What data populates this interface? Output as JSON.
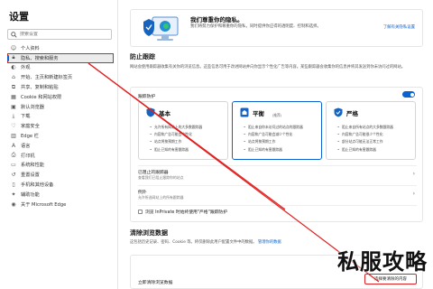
{
  "sidebar": {
    "title": "设置",
    "search_placeholder": "搜索设置",
    "items": [
      {
        "label": "个人资料",
        "icon": "person-icon"
      },
      {
        "label": "隐私、搜索和服务",
        "icon": "lock-icon"
      },
      {
        "label": "外观",
        "icon": "appearance-icon"
      },
      {
        "label": "开始、主页和新建标签页",
        "icon": "home-icon"
      },
      {
        "label": "共享、复制和粘贴",
        "icon": "share-icon"
      },
      {
        "label": "Cookie 和网站权限",
        "icon": "cookie-icon"
      },
      {
        "label": "默认浏览器",
        "icon": "browser-icon"
      },
      {
        "label": "下载",
        "icon": "download-icon"
      },
      {
        "label": "家庭安全",
        "icon": "family-icon"
      },
      {
        "label": "Edge 栏",
        "icon": "edge-bar-icon"
      },
      {
        "label": "语言",
        "icon": "language-icon"
      },
      {
        "label": "打印机",
        "icon": "printer-icon"
      },
      {
        "label": "系统和性能",
        "icon": "system-icon"
      },
      {
        "label": "重置设置",
        "icon": "reset-icon"
      },
      {
        "label": "手机和其他设备",
        "icon": "phone-icon"
      },
      {
        "label": "辅助功能",
        "icon": "accessibility-icon"
      },
      {
        "label": "关于 Microsoft Edge",
        "icon": "edge-logo-icon"
      }
    ]
  },
  "hero": {
    "title": "我们尊重你的隐私。",
    "desc": "我们将努力保护和尊重你的隐私，同时提供你应得的透明度、控制和选择。",
    "link": "了解有关隐私设置"
  },
  "tracking": {
    "title": "防止跟踪",
    "desc": "网站会使用跟踪器收集有关你的浏览信息。这些信息可用于改进网站并向你显示个性化广告等内容。某些跟踪器会收集你的信息并将其发送到你未访问过的网站。",
    "label": "跟踪防护",
    "toggle_on": true,
    "cards": [
      {
        "name": "基本",
        "sub": "",
        "bullets": [
          "允许所有网站上的大多数跟踪器",
          "内容和广告可能会个性化",
          "站点将按预期工作",
          "阻止已知的有害跟踪器"
        ]
      },
      {
        "name": "平衡",
        "sub": "(推荐)",
        "bullets": [
          "阻止来自你未访问过的站点的跟踪器",
          "内容和广告可能会减少个性化",
          "站点将按预期工作",
          "阻止已知的有害跟踪器"
        ]
      },
      {
        "name": "严格",
        "sub": "",
        "bullets": [
          "阻止来自所有站点的大多数跟踪器",
          "内容和广告可能很少个性化",
          "部分站点可能无法正常工作",
          "阻止已知的有害跟踪器"
        ]
      }
    ],
    "rows": [
      {
        "title": "已阻止的跟踪器",
        "desc": "查看我们已阻止跟踪你的站点"
      },
      {
        "title": "例外",
        "desc": "允许所选网站上的所有跟踪器"
      }
    ],
    "inprivate": "浏览 InPrivate 时始终使用\"严格\"跟踪防护"
  },
  "clear": {
    "title": "清除浏览数据",
    "desc": "这包括历史记录、密码、Cookie 等。将仅删除此用户配置文件中的数据。",
    "link": "管理你的数据",
    "row_label": "立即清除浏览数据",
    "button": "选择要清除的内容"
  },
  "watermark": "私服攻略",
  "colors": {
    "accent": "#0a63d0",
    "annotation": "#e02020"
  }
}
